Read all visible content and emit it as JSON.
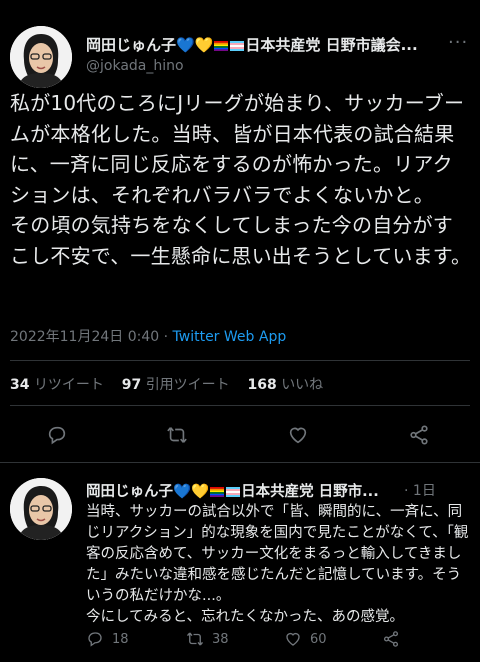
{
  "tweet": {
    "author_name": "岡田じゅん子",
    "author_party": "日本共産党 日野市議会...",
    "handle": "@jokada_hino",
    "more_label": "···",
    "text": "私が10代のころにJリーグが始まり、サッカーブームが本格化した。当時、皆が日本代表の試合結果に、一斉に同じ反応をするのが怖かった。リアクションは、それぞれバラバラでよくないかと。\nその頃の気持ちをなくしてしまった今の自分がすこし不安で、一生懸命に思い出そうとしています。",
    "timestamp": "2022年11月24日 0:40",
    "separator": "·",
    "app": "Twitter Web App",
    "retweets_count": "34",
    "retweets_label": "リツイート",
    "quotes_count": "97",
    "quotes_label": "引用ツイート",
    "likes_count": "168",
    "likes_label": "いいね"
  },
  "reply": {
    "author_name": "岡田じゅん子",
    "author_party": "日本共産党 日野市...",
    "time_sep": "·",
    "time": "1日",
    "text": "当時、サッカーの試合以外で「皆、瞬間的に、一斉に、同じリアクション」的な現象を国内で見たことがなくて、「観客の反応含めて、サッカー文化をまるっと輸入してきました」みたいな違和感を感じたんだと記憶しています。そういうの私だけかな...。\n今にしてみると、忘れたくなかった、あの感覚。",
    "reply_count": "18",
    "retweet_count": "38",
    "like_count": "60"
  },
  "colors": {
    "background": "#000000",
    "text": "#e7e9ea",
    "muted": "#71767b",
    "link": "#1d9bf0",
    "divider": "#2f3336"
  },
  "icons": [
    "blue-heart-icon",
    "yellow-heart-icon",
    "rainbow-flag-icon",
    "trans-flag-icon",
    "more-icon",
    "reply-icon",
    "retweet-icon",
    "like-icon",
    "share-icon"
  ]
}
